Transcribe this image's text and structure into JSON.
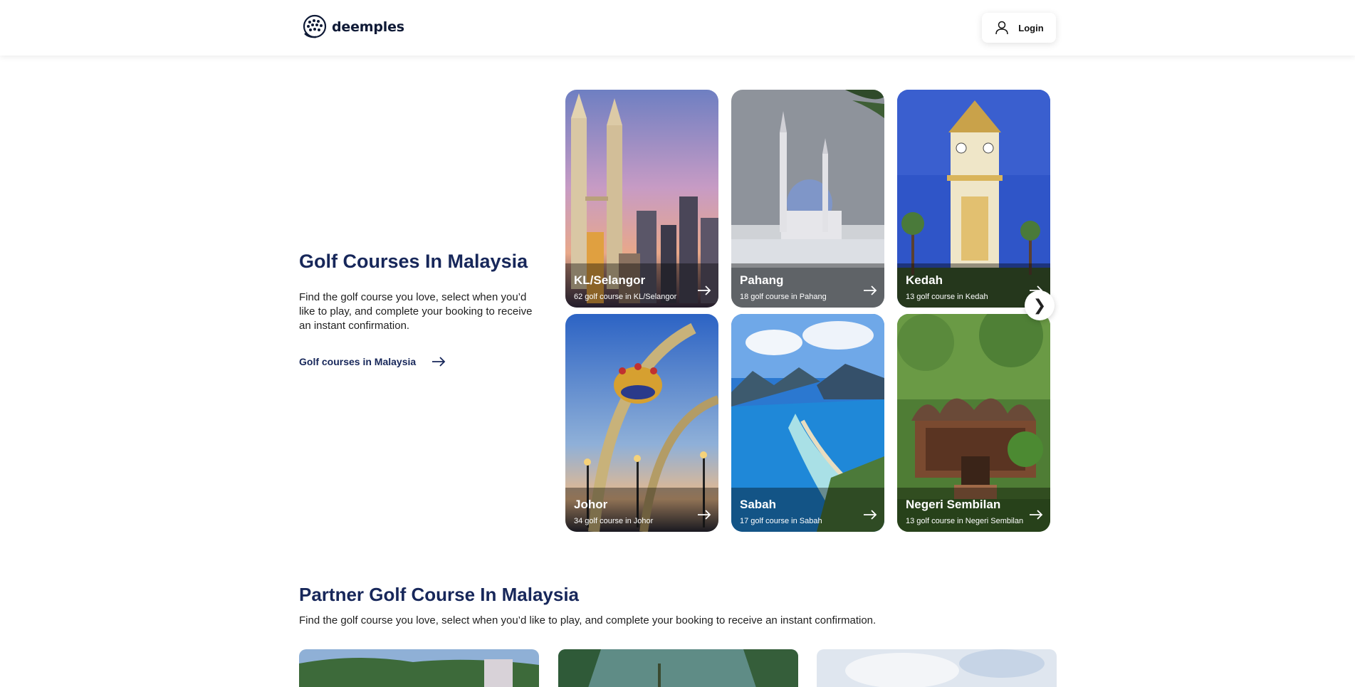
{
  "header": {
    "logo_text": "deemples",
    "login_label": "Login"
  },
  "hero": {
    "title": "Golf Courses In Malaysia",
    "description": "Find the golf course you love, select when you’d like to play, and complete your booking to receive an instant confirmation.",
    "link_label": "Golf courses in Malaysia"
  },
  "regions": [
    {
      "name": "KL/Selangor",
      "count": "62 golf course in KL/Selangor",
      "image": "petronas-towers-skyline"
    },
    {
      "name": "Pahang",
      "count": "18 golf course in Pahang",
      "image": "mosque-blue-dome"
    },
    {
      "name": "Kedah",
      "count": "13 golf course in Kedah",
      "image": "clock-tower"
    },
    {
      "name": "Johor",
      "count": "34 golf course in Johor",
      "image": "crown-arch-monument"
    },
    {
      "name": "Sabah",
      "count": "17 golf course in Sabah",
      "image": "island-sea-aerial"
    },
    {
      "name": "Negeri Sembilan",
      "count": "13 golf course in Negeri Sembilan",
      "image": "traditional-minangkabau-house"
    }
  ],
  "carousel": {
    "next_icon": "chevron-right-icon",
    "next_glyph": "❯"
  },
  "partner": {
    "title": "Partner Golf Course In Malaysia",
    "description": "Find the golf course you love, select when you’d like to play, and complete your booking to receive an instant confirmation."
  },
  "colors": {
    "brand_navy": "#17275a",
    "background": "#ffffff"
  }
}
